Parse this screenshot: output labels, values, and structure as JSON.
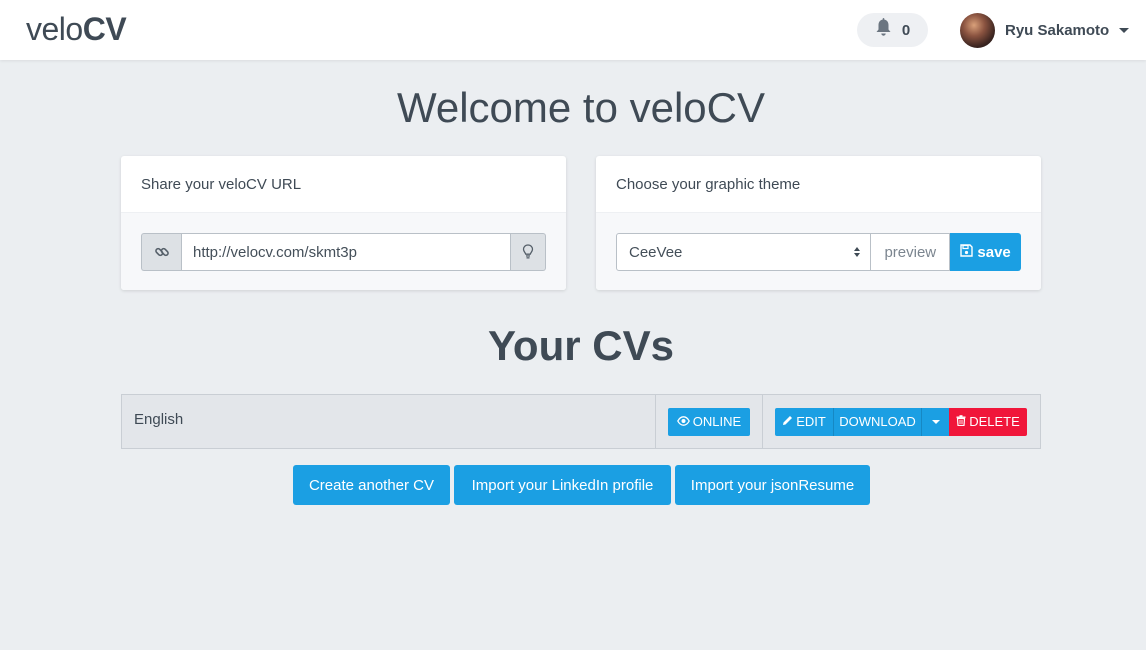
{
  "header": {
    "logo_light": "velo",
    "logo_bold": "CV",
    "notifications_count": "0",
    "notifications_icon": "bell-icon",
    "user_name": "Ryu Sakamoto"
  },
  "page_title": "Welcome to veloCV",
  "share_card": {
    "heading": "Share your veloCV URL",
    "url_value": "http://velocv.com/skmt3p",
    "left_icon": "link-icon",
    "right_icon": "lightbulb-icon"
  },
  "theme_card": {
    "heading": "Choose your graphic theme",
    "selected_theme": "CeeVee",
    "preview_label": "preview",
    "save_label": "save",
    "save_icon": "floppy-icon"
  },
  "cvs_title": "Your CVs",
  "cvs": [
    {
      "name": "English",
      "online_label": "ONLINE",
      "edit_label": "EDIT",
      "download_label": "DOWNLOAD",
      "delete_label": "DELETE"
    }
  ],
  "actions": {
    "create_label": "Create another CV",
    "linkedin_label": "Import your LinkedIn profile",
    "jsonresume_label": "Import your jsonResume"
  },
  "colors": {
    "accent": "#1b9fe3",
    "danger": "#f0163a",
    "background": "#ebeef1"
  }
}
